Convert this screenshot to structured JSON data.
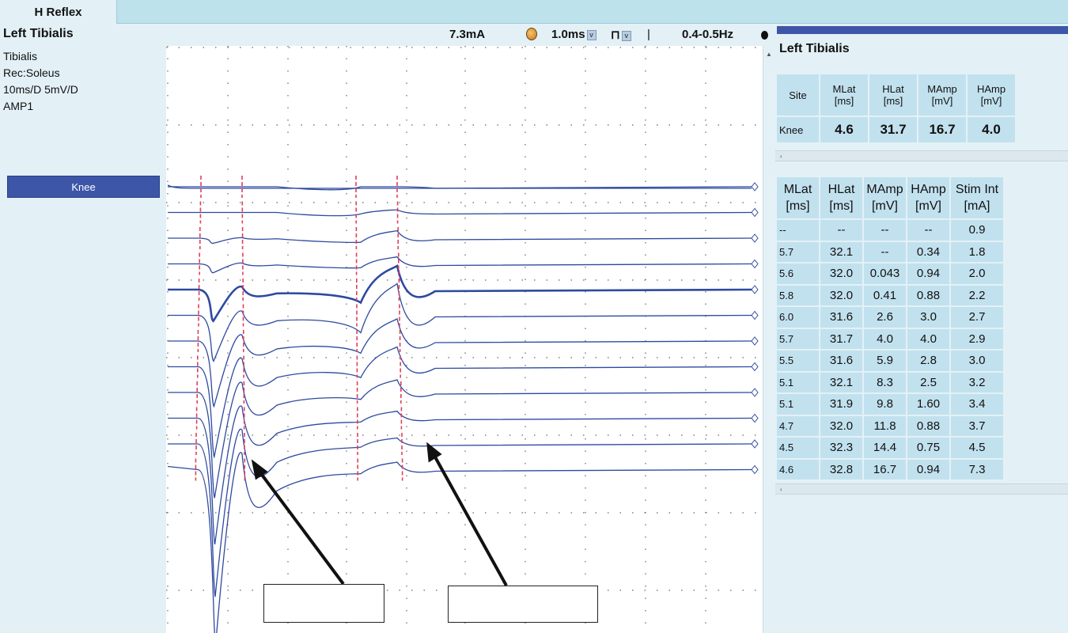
{
  "tab": {
    "label": "H Reflex"
  },
  "left": {
    "title": "Left Tibialis",
    "info": [
      "Tibialis",
      "Rec:Soleus",
      "10ms/D  5mV/D",
      "AMP1"
    ],
    "site_button": "Knee"
  },
  "toolbar": {
    "intensity": "7.3mA",
    "duration": "1.0ms",
    "frequency": "0.4-0.5Hz",
    "dd_glyph": "v",
    "pulse_glyph": "⊓",
    "separator": "|"
  },
  "right": {
    "title": "Left Tibialis",
    "scroll_glyph": "‹",
    "summary": {
      "headers": [
        "Site",
        "MLat\n[ms]",
        "HLat\n[ms]",
        "MAmp\n[mV]",
        "HAmp\n[mV]"
      ],
      "row": [
        "Knee",
        "4.6",
        "31.7",
        "16.7",
        "4.0"
      ]
    },
    "detail": {
      "headers": [
        "MLat\n[ms]",
        "HLat\n[ms]",
        "MAmp\n[mV]",
        "HAmp\n[mV]",
        "Stim Int\n[mA]"
      ],
      "rows": [
        [
          "--",
          "--",
          "--",
          "--",
          "0.9"
        ],
        [
          "5.7",
          "32.1",
          "--",
          "0.34",
          "1.8"
        ],
        [
          "5.6",
          "32.0",
          "0.043",
          "0.94",
          "2.0"
        ],
        [
          "5.8",
          "32.0",
          "0.41",
          "0.88",
          "2.2"
        ],
        [
          "6.0",
          "31.6",
          "2.6",
          "3.0",
          "2.7"
        ],
        [
          "5.7",
          "31.7",
          "4.0",
          "4.0",
          "2.9"
        ],
        [
          "5.5",
          "31.6",
          "5.9",
          "2.8",
          "3.0"
        ],
        [
          "5.1",
          "32.1",
          "8.3",
          "2.5",
          "3.2"
        ],
        [
          "5.1",
          "31.9",
          "9.8",
          "1.60",
          "3.4"
        ],
        [
          "4.7",
          "32.0",
          "11.8",
          "0.88",
          "3.7"
        ],
        [
          "4.5",
          "32.3",
          "14.4",
          "0.75",
          "4.5"
        ],
        [
          "4.6",
          "32.8",
          "16.7",
          "0.94",
          "7.3"
        ]
      ]
    }
  },
  "colors": {
    "trace": "#2e4aa0",
    "cursor": "#e0405a",
    "grid_dot": "#666666",
    "header_bg": "#bde2ec",
    "cell_bg": "#c2e1ee",
    "button_bg": "#3d56a8"
  }
}
